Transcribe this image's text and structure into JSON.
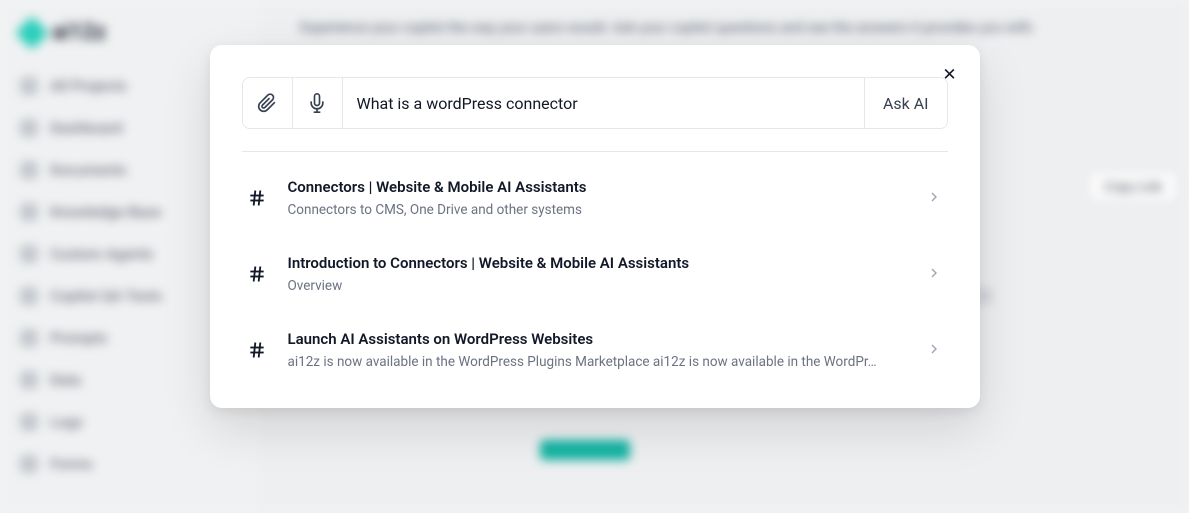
{
  "logo": {
    "text": "ai12z"
  },
  "sidebar": {
    "items": [
      {
        "label": "All Projects"
      },
      {
        "label": "Dashboard"
      },
      {
        "label": "Documents"
      },
      {
        "label": "Knowledge Base"
      },
      {
        "label": "Custom Agents"
      },
      {
        "label": "Copilot QA Tests"
      },
      {
        "label": "Prompts"
      },
      {
        "label": "Data"
      },
      {
        "label": "Logs"
      },
      {
        "label": "Forms"
      }
    ]
  },
  "header": {
    "text": "Experience your copilot the way your users would. Ask your copilot questions and see the answers it provides you with."
  },
  "buttons": {
    "copy_link": "Copy Link"
  },
  "modal": {
    "close": "✕",
    "search_value": "What is a wordPress connector",
    "ask_ai": "Ask AI",
    "results": [
      {
        "title": "Connectors | Website & Mobile AI Assistants",
        "desc": "Connectors to CMS, One Drive and other systems"
      },
      {
        "title": "Introduction to Connectors | Website & Mobile AI Assistants",
        "desc": "Overview"
      },
      {
        "title": "Launch AI Assistants on WordPress Websites",
        "desc": "ai12z is now available in the WordPress Plugins Marketplace ai12z is now available in the WordPr…"
      }
    ]
  }
}
